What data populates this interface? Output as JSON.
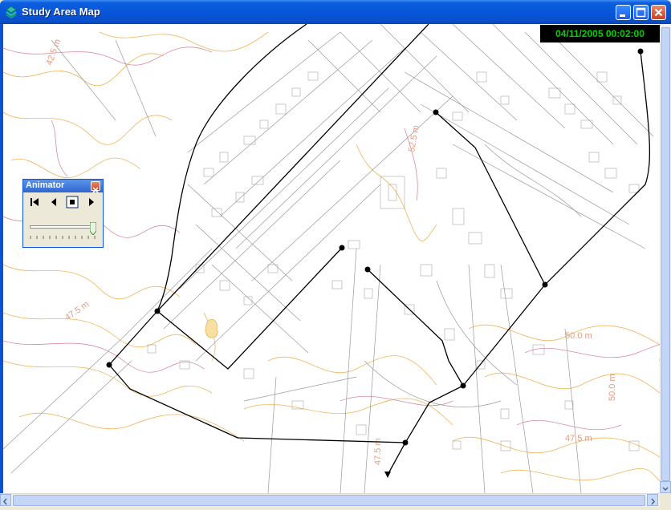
{
  "window": {
    "title": "Study Area Map",
    "icons": {
      "app": "map-layers-icon",
      "minimize": "minimize-icon",
      "maximize": "maximize-icon",
      "close": "close-icon"
    }
  },
  "map": {
    "timestamp": "04/11/2005 00:02:00",
    "contour_labels": [
      "42.5 m",
      "47.5 m",
      "50.0 m",
      "47.5 m",
      "52.5 m",
      "47.5 m",
      "50.0 m"
    ],
    "colors": {
      "contour_orange": "#f0b45a",
      "contour_pink": "#d88aa0",
      "streets": "#9a9a9a",
      "network": "#000000",
      "clock_text": "#00d000"
    }
  },
  "animator": {
    "title": "Animator",
    "controls": [
      "rewind-to-start-icon",
      "step-back-icon",
      "stop-icon",
      "play-icon"
    ],
    "slider_position": 1.0
  }
}
